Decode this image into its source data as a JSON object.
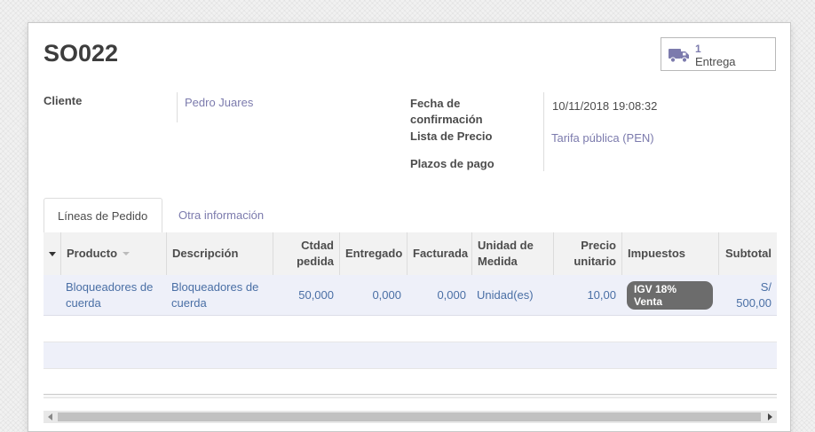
{
  "order": {
    "title": "SO022"
  },
  "smart_button": {
    "count": "1",
    "label": "Entrega",
    "icon": "truck-icon"
  },
  "fields": {
    "cliente_label": "Cliente",
    "cliente_value": "Pedro Juares",
    "fecha_label": "Fecha de confirmación",
    "fecha_value": "10/11/2018 19:08:32",
    "lista_label": "Lista de Precio",
    "lista_value": "Tarifa pública (PEN)",
    "plazos_label": "Plazos de pago"
  },
  "tabs": [
    {
      "label": "Líneas de Pedido",
      "active": true
    },
    {
      "label": "Otra información",
      "active": false
    }
  ],
  "table": {
    "headers": [
      "Producto",
      "Descripción",
      "Ctdad pedida",
      "Entregado",
      "Facturada",
      "Unidad de Medida",
      "Precio unitario",
      "Impuestos",
      "Subtotal"
    ],
    "rows": [
      {
        "producto": "Bloqueadores de cuerda",
        "descripcion": "Bloqueadores de cuerda",
        "ctdad": "50,000",
        "entregado": "0,000",
        "facturada": "0,000",
        "unidad": "Unidad(es)",
        "precio": "10,00",
        "impuestos": "IGV 18% Venta",
        "subtotal": "S/ 500,00"
      }
    ]
  },
  "colors": {
    "accent": "#7c7bad",
    "link": "#4a6fa5",
    "row_highlight": "#eef0f9",
    "badge": "#6c6c6c"
  }
}
